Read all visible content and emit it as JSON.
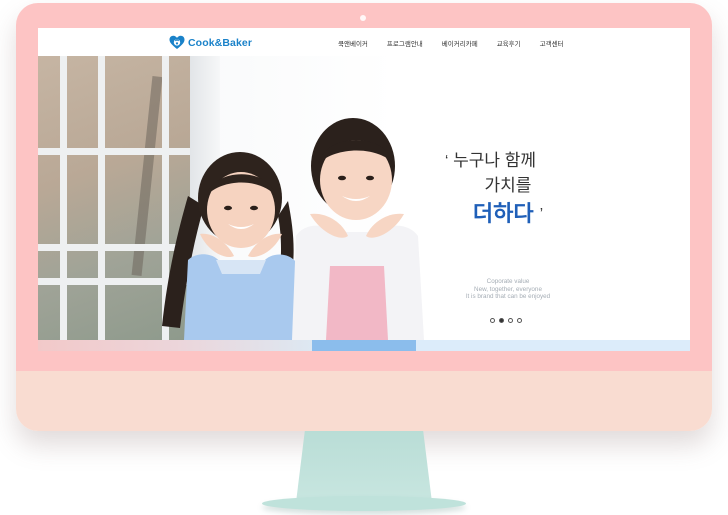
{
  "brand": {
    "name": "Cook&Baker",
    "color": "#1a82c9"
  },
  "nav": {
    "items": [
      "쿡앤베이커",
      "프로그램안내",
      "베이커리카페",
      "교육후기",
      "고객센터"
    ]
  },
  "hero": {
    "line1": "누구나 함께",
    "line2": "가치를",
    "line3": "더하다",
    "open_quote": "‘",
    "close_quote": "’",
    "highlight_color": "#1f5fb8",
    "sub": {
      "line1": "Coporate value",
      "line2": "New, together, everyone",
      "line3": "It is brand that can be enjoyed"
    }
  },
  "slider": {
    "dot_count": 4,
    "active_index": 1
  },
  "colors": {
    "bezel": "#fdc4c4",
    "chin": "#f9dcd1",
    "stand": "#bfe2db"
  }
}
